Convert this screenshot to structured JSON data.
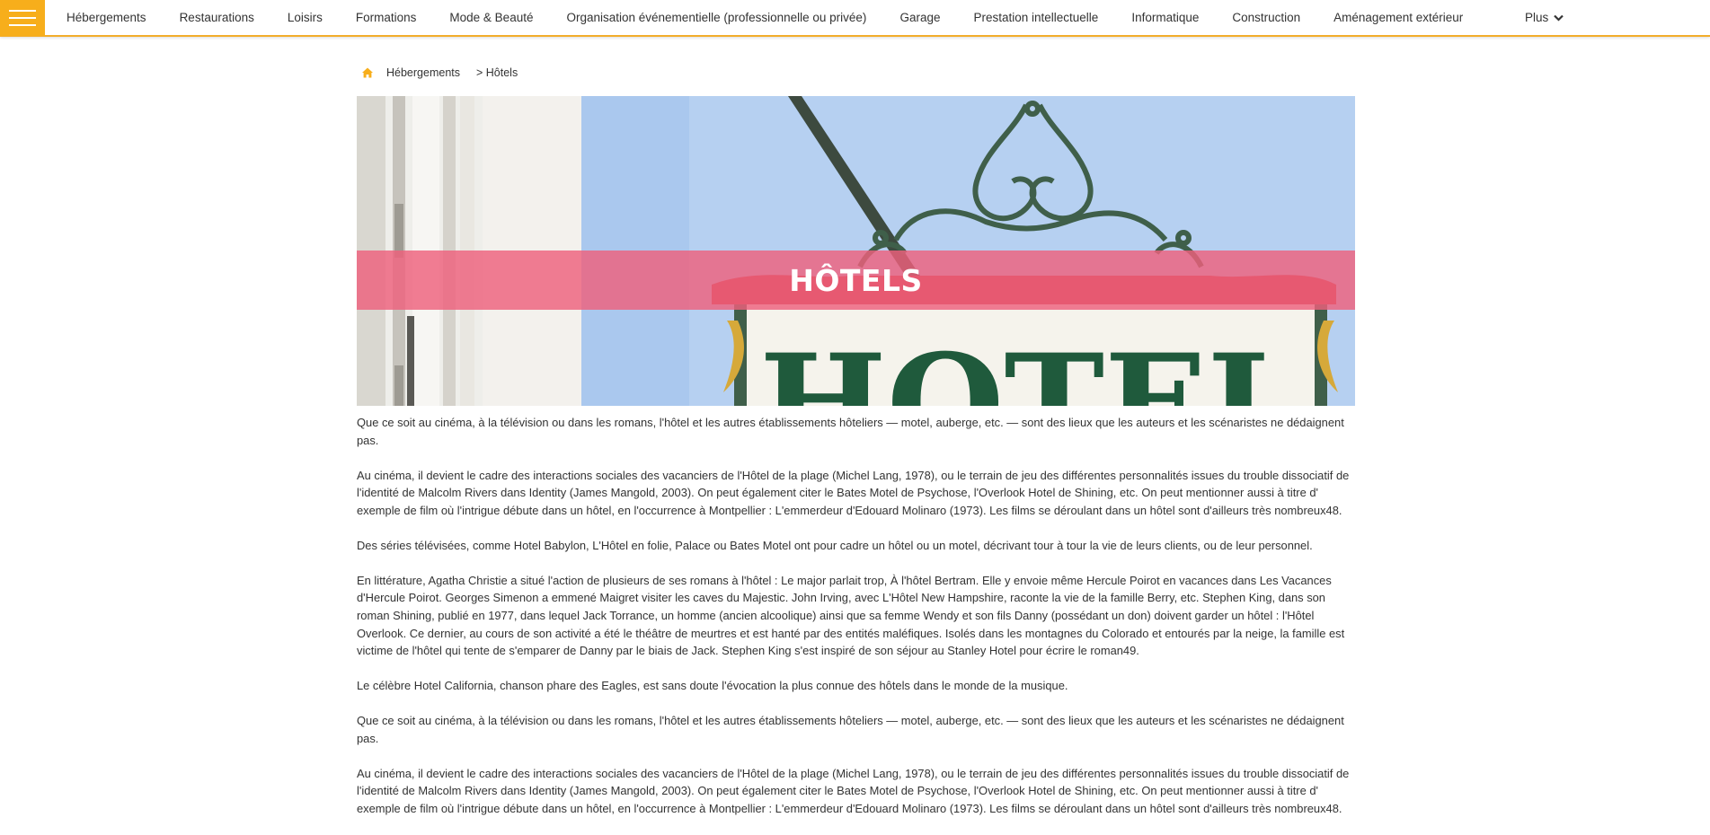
{
  "nav": {
    "items": [
      "Hébergements",
      "Restaurations",
      "Loisirs",
      "Formations",
      "Mode & Beauté",
      "Organisation événementielle (professionnelle ou privée)",
      "Garage",
      "Prestation intellectuelle",
      "Informatique",
      "Construction",
      "Aménagement extérieur"
    ],
    "more_label": "Plus"
  },
  "breadcrumb": {
    "home_icon": "home-icon",
    "parent": "Hébergements",
    "current": "> Hôtels"
  },
  "banner": {
    "title": "HÔTELS",
    "sign_text": "HOTEL"
  },
  "article": {
    "paragraphs": [
      "Que ce soit au cinéma, à la télévision ou dans les romans, l'hôtel et les autres établissements hôteliers — motel, auberge, etc. — sont des lieux que les auteurs et les scénaristes ne dédaignent pas.",
      "Au cinéma, il devient le cadre des interactions sociales des vacanciers de l'Hôtel de la plage (Michel Lang, 1978), ou le terrain de jeu des différentes personnalités issues du trouble dissociatif de l'identité de Malcolm Rivers dans Identity (James Mangold, 2003). On peut également citer le Bates Motel de Psychose, l'Overlook Hotel de Shining, etc. On peut mentionner aussi à titre d' exemple de film où l'intrigue débute dans un hôtel, en l'occurrence à Montpellier : L'emmerdeur d'Edouard Molinaro (1973). Les films se déroulant dans un hôtel sont d'ailleurs très nombreux48.",
      "Des séries télévisées, comme Hotel Babylon, L'Hôtel en folie, Palace ou Bates Motel ont pour cadre un hôtel ou un motel, décrivant tour à tour la vie de leurs clients, ou de leur personnel.",
      "En littérature, Agatha Christie a situé l'action de plusieurs de ses romans à l'hôtel : Le major parlait trop, À l'hôtel Bertram. Elle y envoie même Hercule Poirot en vacances dans Les Vacances d'Hercule Poirot. Georges Simenon a emmené Maigret visiter les caves du Majestic. John Irving, avec L'Hôtel New Hampshire, raconte la vie de la famille Berry, etc. Stephen King, dans son roman Shining, publié en 1977, dans lequel Jack Torrance, un homme (ancien alcoolique) ainsi que sa femme Wendy et son fils Danny (possédant un don) doivent garder un hôtel : l'Hôtel Overlook. Ce dernier, au cours de son activité a été le théâtre de meurtres et est hanté par des entités maléfiques. Isolés dans les montagnes du Colorado et entourés par la neige, la famille est victime de l'hôtel qui tente de s'emparer de Danny par le biais de Jack. Stephen King s'est inspiré de son séjour au Stanley Hotel pour écrire le roman49.",
      "Le célèbre Hotel California, chanson phare des Eagles, est sans doute l'évocation la plus connue des hôtels dans le monde de la musique.",
      "Que ce soit au cinéma, à la télévision ou dans les romans, l'hôtel et les autres établissements hôteliers — motel, auberge, etc. — sont des lieux que les auteurs et les scénaristes ne dédaignent pas.",
      "Au cinéma, il devient le cadre des interactions sociales des vacanciers de l'Hôtel de la plage (Michel Lang, 1978), ou le terrain de jeu des différentes personnalités issues du trouble dissociatif de l'identité de Malcolm Rivers dans Identity (James Mangold, 2003). On peut également citer le Bates Motel de Psychose, l'Overlook Hotel de Shining, etc. On peut mentionner aussi à titre d' exemple de film où l'intrigue débute dans un hôtel, en l'occurrence à Montpellier : L'emmerdeur d'Edouard Molinaro (1973). Les films se déroulant dans un hôtel sont d'ailleurs très nombreux48."
    ]
  },
  "colors": {
    "accent": "#f7ae1b",
    "banner_strip": "#ee607c",
    "text": "#333333"
  }
}
